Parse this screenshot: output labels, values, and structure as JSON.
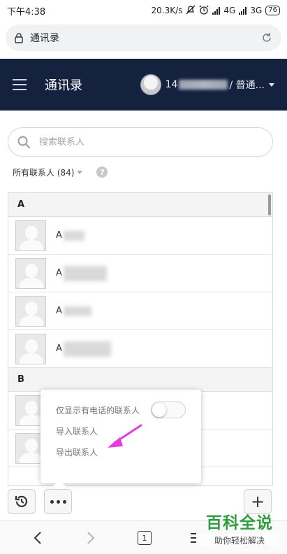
{
  "status_bar": {
    "time": "下午4:38",
    "net_speed": "20.3K/s",
    "net1": "4G",
    "net2": "3G",
    "battery": "76"
  },
  "browser": {
    "url_text": "通讯录",
    "tab_count": "1"
  },
  "header": {
    "title": "通讯录",
    "user_prefix": "14",
    "user_suffix": "/ 普通..."
  },
  "search": {
    "placeholder": "搜索联系人"
  },
  "filter": {
    "label": "所有联系人 (84)",
    "help": "?"
  },
  "groups": [
    {
      "letter": "A",
      "contacts": [
        {
          "name": "A"
        },
        {
          "name": "A"
        },
        {
          "name": "A"
        },
        {
          "name": "A"
        }
      ]
    },
    {
      "letter": "B",
      "contacts": [
        {
          "name": ""
        },
        {
          "name": ""
        }
      ]
    }
  ],
  "popup": {
    "toggle_label": "仅显示有电话的联系人",
    "toggle_on": false,
    "import_label": "导入联系人",
    "export_label": "导出联系人"
  },
  "actions": {
    "add_label": "+"
  },
  "watermark": {
    "main": "百科全说",
    "sub": "助你轻松解决"
  },
  "colors": {
    "header_bg": "#14213f",
    "annotation": "#e33be0",
    "watermark": "#2e9e3e"
  }
}
